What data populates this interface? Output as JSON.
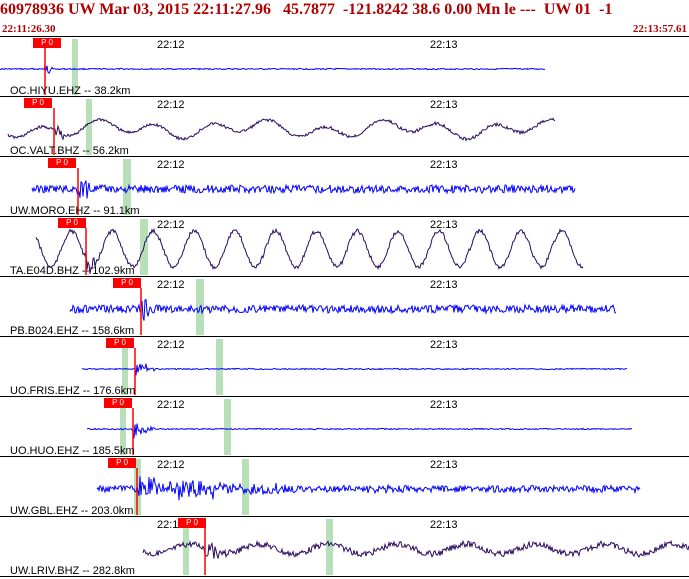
{
  "header": {
    "title": "60978936 UW Mar 03, 2015 22:11:27.96   45.7877  -121.8242 38.6 0.00 Mn le ---  UW 01  -1",
    "start_time": "22:11:26.30",
    "end_time": "22:13:57.61"
  },
  "colors": {
    "header_text": "#b00000",
    "trace_blue": "#0000ff",
    "trace_purple": "#2b0a5e",
    "pick": "#ff0000",
    "window": "#b8e0b8"
  },
  "pick_label": "P 0",
  "traces": [
    {
      "label": "OC.HIYU.EHZ -- 38.2km",
      "ticks": [
        "22:12",
        "22:13"
      ],
      "color": "blue"
    },
    {
      "label": "OC.VALT.BHZ -- 56.2km",
      "ticks": [
        "22:12",
        "22:13"
      ],
      "color": "purple"
    },
    {
      "label": "UW.MORO.EHZ -- 91.1km",
      "ticks": [
        "22:12",
        "22:13"
      ],
      "color": "blue"
    },
    {
      "label": "TA.E04D.BHZ -- 102.9km",
      "ticks": [
        "22:12",
        "22:13"
      ],
      "color": "purple"
    },
    {
      "label": "PB.B024.EHZ -- 158.6km",
      "ticks": [
        "22:12",
        "22:13"
      ],
      "color": "blue"
    },
    {
      "label": "UO.FRIS.EHZ -- 176.6km",
      "ticks": [
        "22:12",
        "22:13"
      ],
      "color": "blue"
    },
    {
      "label": "UO.HUO.EHZ -- 185.5km",
      "ticks": [
        "22:12",
        "22:13"
      ],
      "color": "blue"
    },
    {
      "label": "UW.GBL.EHZ -- 203.0km",
      "ticks": [
        "22:12",
        "22:13"
      ],
      "color": "blue"
    },
    {
      "label": "UW.LRIV.BHZ -- 282.8km",
      "ticks": [
        "22:12",
        "22:13"
      ],
      "color": "purple"
    }
  ]
}
